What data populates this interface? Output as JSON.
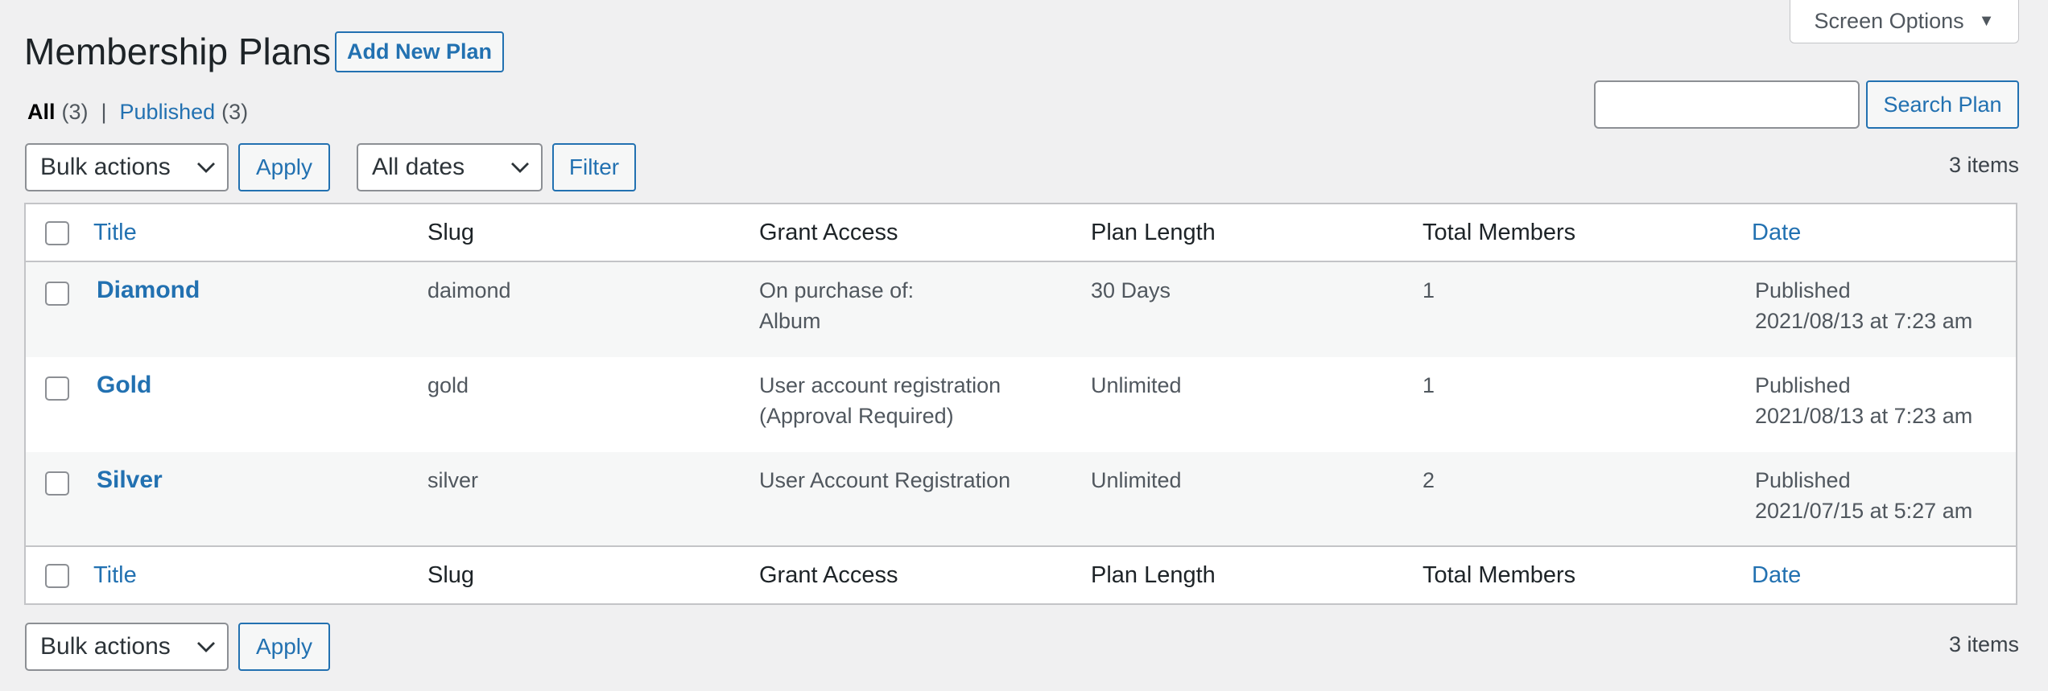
{
  "screen_options": {
    "label": "Screen Options"
  },
  "page": {
    "title": "Membership Plans",
    "add_new_label": "Add New Plan"
  },
  "views": {
    "all_label": "All",
    "all_count": "(3)",
    "separator": "|",
    "published_label": "Published",
    "published_count": "(3)"
  },
  "search": {
    "value": "",
    "placeholder": "",
    "button_label": "Search Plan"
  },
  "top_nav": {
    "bulk_actions": "Bulk actions",
    "apply_label": "Apply",
    "dates": "All dates",
    "filter_label": "Filter",
    "items_count": "3 items"
  },
  "table": {
    "columns": {
      "title": "Title",
      "slug": "Slug",
      "grant_access": "Grant Access",
      "plan_length": "Plan Length",
      "total_members": "Total Members",
      "date": "Date"
    },
    "rows": [
      {
        "title": "Diamond",
        "slug": "daimond",
        "grant_access_1": "On purchase of:",
        "grant_access_2": "Album",
        "plan_length": "30 Days",
        "total_members": "1",
        "status": "Published",
        "date": "2021/08/13 at 7:23 am"
      },
      {
        "title": "Gold",
        "slug": "gold",
        "grant_access_1": "User account registration",
        "grant_access_2": "(Approval Required)",
        "plan_length": "Unlimited",
        "total_members": "1",
        "status": "Published",
        "date": "2021/08/13 at 7:23 am"
      },
      {
        "title": "Silver",
        "slug": "silver",
        "grant_access_1": "User Account Registration",
        "grant_access_2": "",
        "plan_length": "Unlimited",
        "total_members": "2",
        "status": "Published",
        "date": "2021/07/15 at 5:27 am"
      }
    ]
  },
  "bottom_nav": {
    "bulk_actions": "Bulk actions",
    "apply_label": "Apply",
    "items_count": "3 items"
  },
  "colors": {
    "accent": "#2271b1",
    "background": "#f0f0f1"
  },
  "icons": {
    "dropdown_arrow": "triangle-down-icon",
    "select_chevron": "chevron-down-icon"
  }
}
